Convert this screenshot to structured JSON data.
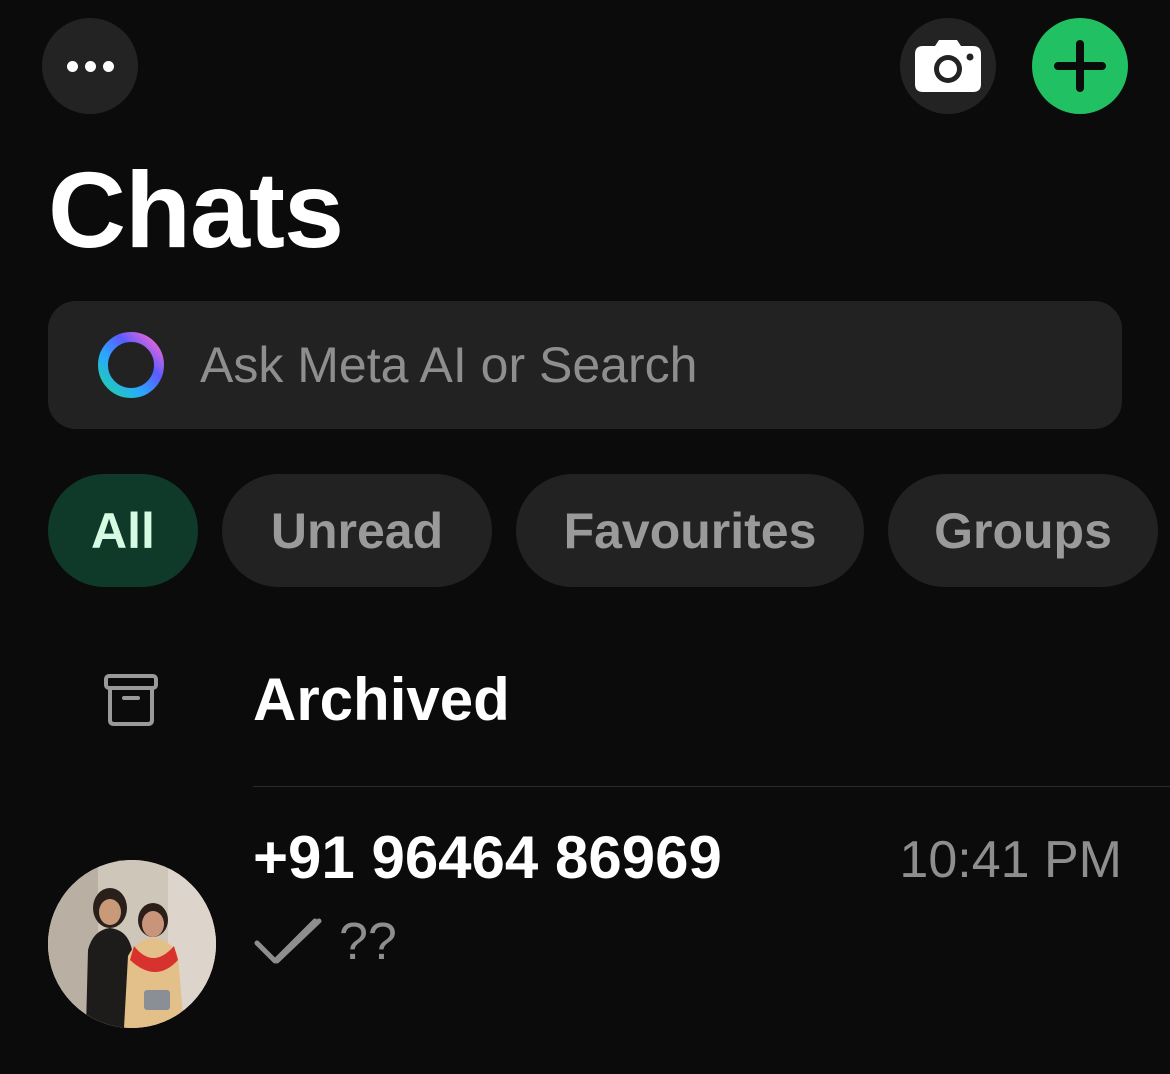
{
  "header": {
    "title": "Chats",
    "more_icon": "more-horizontal-icon",
    "camera_icon": "camera-icon",
    "new_chat_icon": "plus-icon",
    "accent_color": "#21c063"
  },
  "search": {
    "placeholder": "Ask Meta AI or Search",
    "icon": "meta-ai-ring-icon"
  },
  "filters": [
    {
      "label": "All",
      "active": true
    },
    {
      "label": "Unread",
      "active": false
    },
    {
      "label": "Favourites",
      "active": false
    },
    {
      "label": "Groups",
      "active": false
    }
  ],
  "archived": {
    "label": "Archived",
    "icon": "archive-icon"
  },
  "chats": [
    {
      "name": "+91 96464 86969",
      "time": "10:41 PM",
      "preview": "??",
      "status_icon": "double-check-icon",
      "avatar": "contact-avatar"
    }
  ]
}
